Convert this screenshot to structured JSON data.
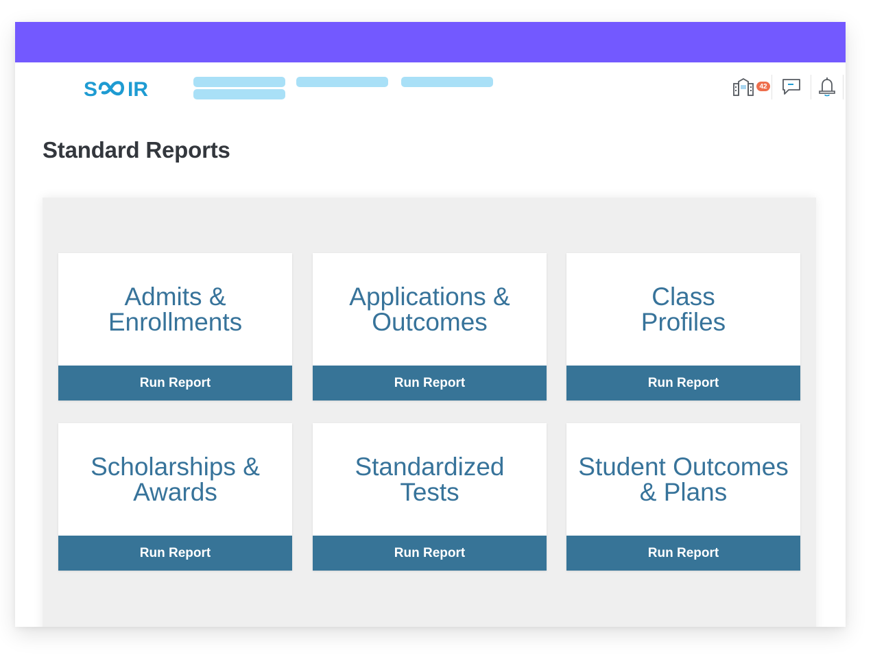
{
  "colors": {
    "topbar": "#7359ff",
    "logo": "#1e9bd2",
    "nav_placeholder": "#a9e0f7",
    "badge": "#ee6e4c",
    "card_title": "#37739a",
    "run_button": "#377497",
    "panel_bg": "#efefef"
  },
  "header": {
    "logo_text": "SCOIR",
    "nav_items": [
      "",
      "",
      "",
      ""
    ],
    "icons": [
      {
        "name": "school-building-icon",
        "badge": "42"
      },
      {
        "name": "message-icon"
      },
      {
        "name": "bell-icon"
      }
    ]
  },
  "page": {
    "title": "Standard Reports"
  },
  "reports": [
    {
      "title_line1": "Admits &",
      "title_line2": "Enrollments",
      "button": "Run Report"
    },
    {
      "title_line1": "Applications &",
      "title_line2": "Outcomes",
      "button": "Run Report"
    },
    {
      "title_line1": "Class",
      "title_line2": "Profiles",
      "button": "Run Report"
    },
    {
      "title_line1": "Scholarships &",
      "title_line2": "Awards",
      "button": "Run Report"
    },
    {
      "title_line1": "Standardized",
      "title_line2": "Tests",
      "button": "Run Report"
    },
    {
      "title_line1": "Student Outcomes",
      "title_line2": "& Plans",
      "button": "Run Report"
    }
  ]
}
